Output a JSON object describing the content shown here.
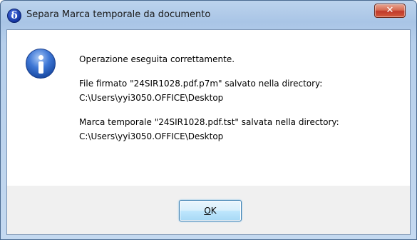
{
  "window": {
    "title": "Separa Marca temporale da documento",
    "close_symbol": "✕"
  },
  "app_icon": {
    "glyph": "δ",
    "icon": "delta-logo-icon"
  },
  "info_icon": {
    "icon": "info-icon"
  },
  "message": {
    "line1": "Operazione eseguita correttamente.",
    "line2": "File firmato \"24SIR1028.pdf.p7m\" salvato nella directory:",
    "line3": "C:\\Users\\yyi3050.OFFICE\\Desktop",
    "line4": "Marca temporale \"24SIR1028.pdf.tst\" salvata nella directory:",
    "line5": "C:\\Users\\yyi3050.OFFICE\\Desktop"
  },
  "buttons": {
    "ok_mnemonic": "O",
    "ok_rest": "K"
  },
  "colors": {
    "close_button": "#c0392b",
    "info_icon": "#3f78d6",
    "app_icon": "#13339e"
  }
}
